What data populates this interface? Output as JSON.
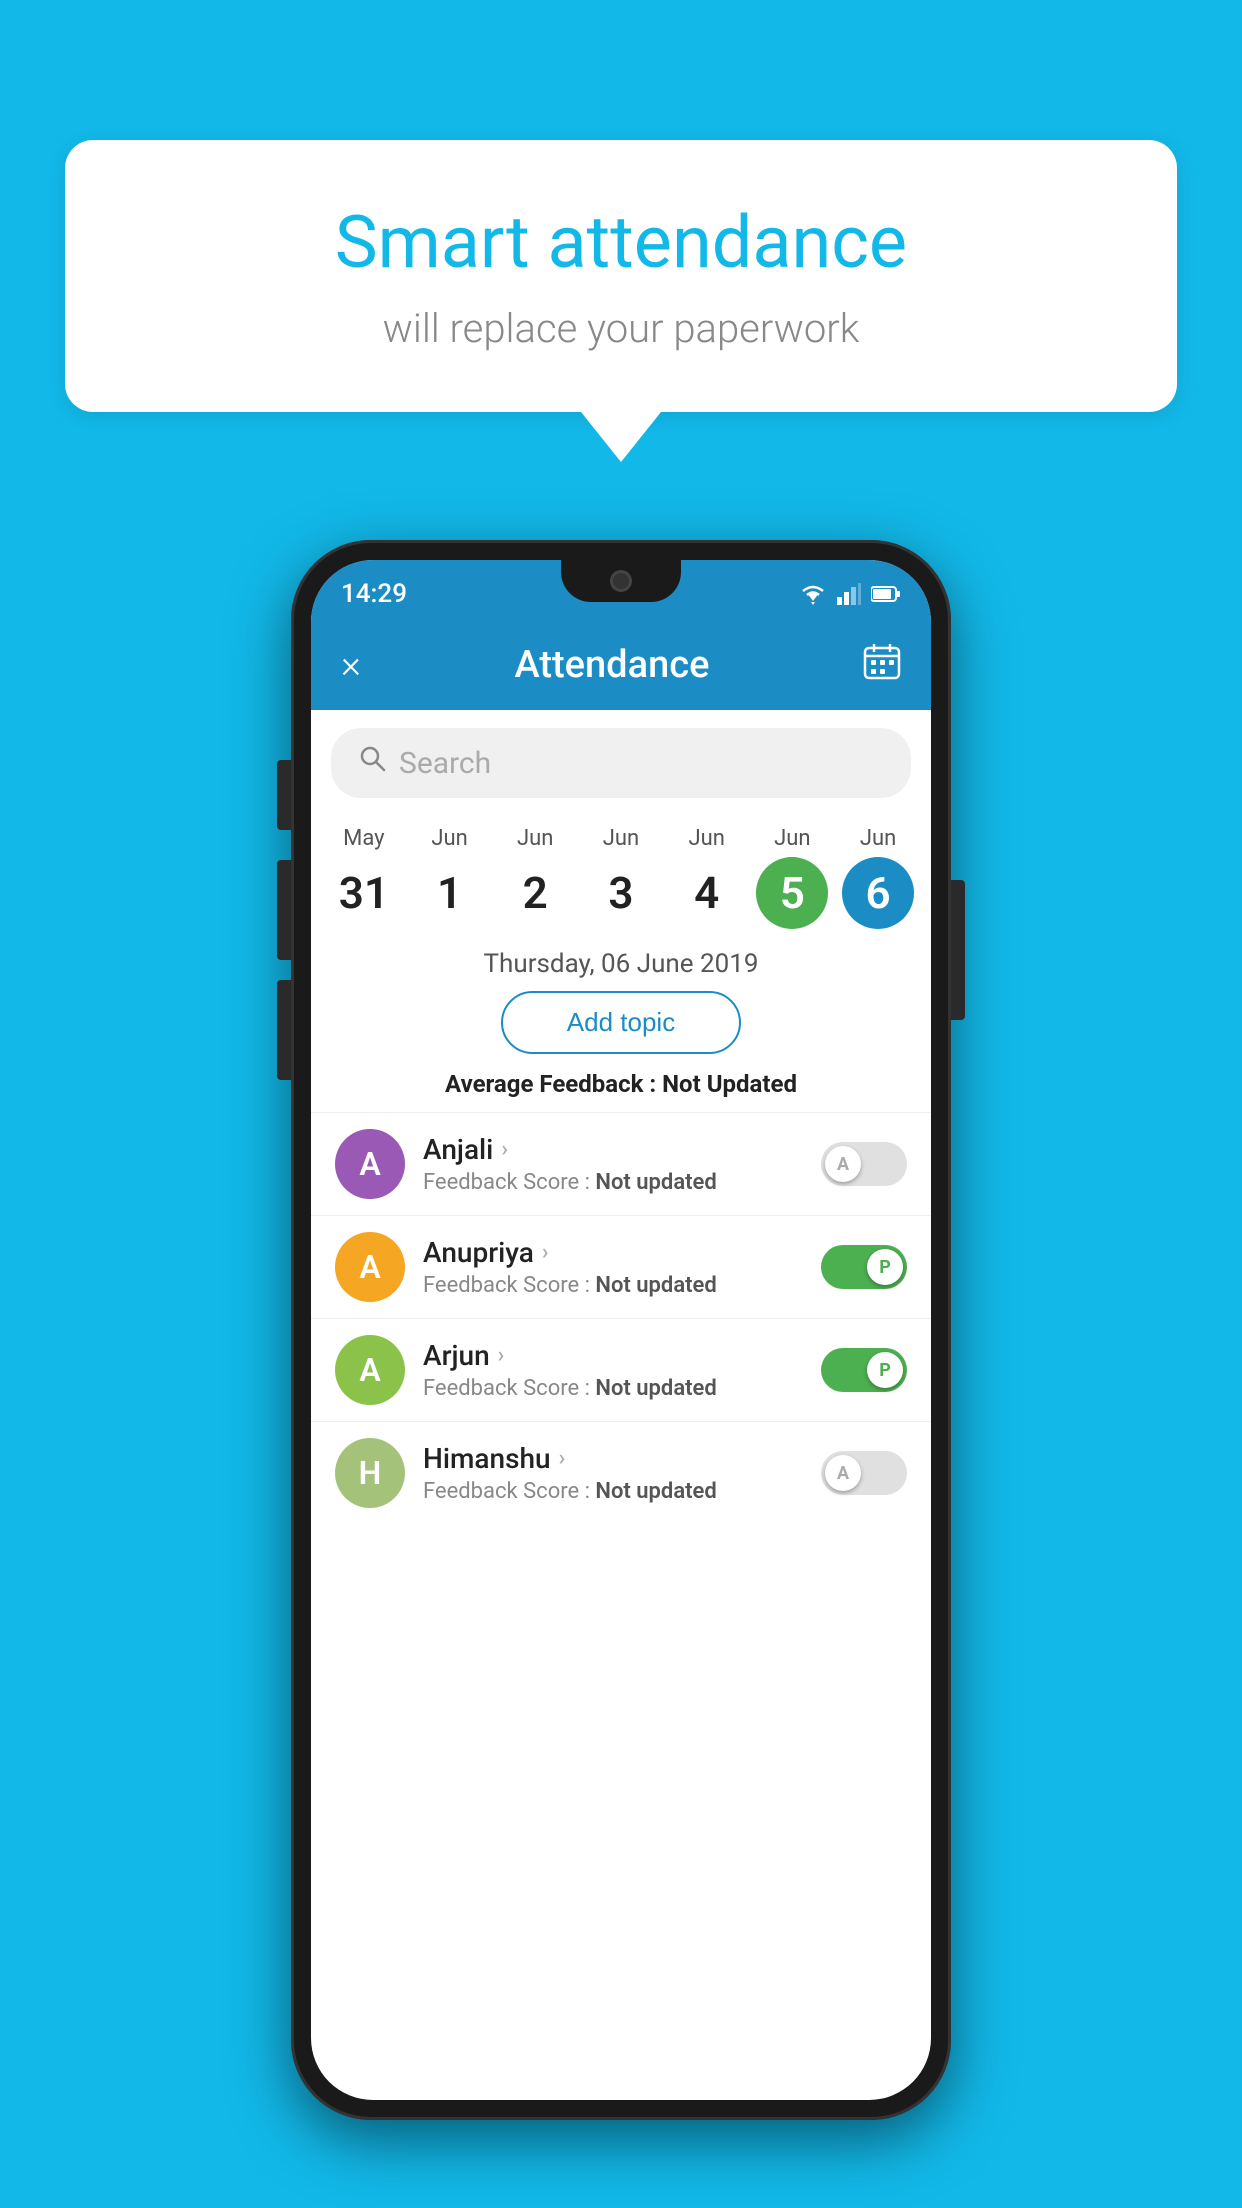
{
  "background_color": "#12B8E8",
  "speech_bubble": {
    "title": "Smart attendance",
    "subtitle": "will replace your paperwork"
  },
  "status_bar": {
    "time": "14:29"
  },
  "app_header": {
    "title": "Attendance",
    "close_label": "×",
    "calendar_icon": "calendar-icon"
  },
  "search": {
    "placeholder": "Search"
  },
  "calendar": {
    "days": [
      {
        "month": "May",
        "date": "31",
        "style": "normal"
      },
      {
        "month": "Jun",
        "date": "1",
        "style": "normal"
      },
      {
        "month": "Jun",
        "date": "2",
        "style": "normal"
      },
      {
        "month": "Jun",
        "date": "3",
        "style": "normal"
      },
      {
        "month": "Jun",
        "date": "4",
        "style": "normal"
      },
      {
        "month": "Jun",
        "date": "5",
        "style": "green"
      },
      {
        "month": "Jun",
        "date": "6",
        "style": "blue"
      }
    ],
    "selected_date": "Thursday, 06 June 2019"
  },
  "add_topic_label": "Add topic",
  "avg_feedback_label": "Average Feedback :",
  "avg_feedback_value": "Not Updated",
  "students": [
    {
      "name": "Anjali",
      "initial": "A",
      "avatar_color": "#9B59B6",
      "feedback_label": "Feedback Score :",
      "feedback_value": "Not updated",
      "toggle": "off",
      "toggle_letter": "A"
    },
    {
      "name": "Anupriya",
      "initial": "A",
      "avatar_color": "#F5A623",
      "feedback_label": "Feedback Score :",
      "feedback_value": "Not updated",
      "toggle": "on",
      "toggle_letter": "P"
    },
    {
      "name": "Arjun",
      "initial": "A",
      "avatar_color": "#8BC34A",
      "feedback_label": "Feedback Score :",
      "feedback_value": "Not updated",
      "toggle": "on",
      "toggle_letter": "P"
    },
    {
      "name": "Himanshu",
      "initial": "H",
      "avatar_color": "#A5C27A",
      "feedback_label": "Feedback Score :",
      "feedback_value": "Not updated",
      "toggle": "off",
      "toggle_letter": "A"
    }
  ]
}
